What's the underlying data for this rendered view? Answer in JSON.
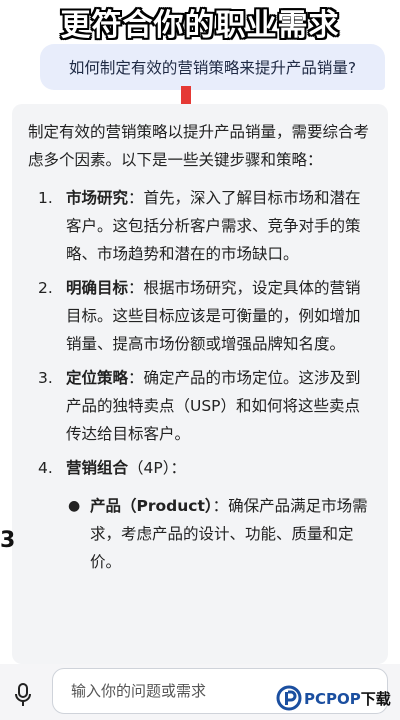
{
  "banner": {
    "text": "更符合你的职业需求"
  },
  "question": {
    "text": "如何制定有效的营销策略来提升产品销量?"
  },
  "answer": {
    "intro": "制定有效的营销策略以提升产品销量，需要综合考虑多个因素。以下是一些关键步骤和策略：",
    "steps": [
      {
        "num": "1.",
        "title": "市场研究",
        "text": "：首先，深入了解目标市场和潜在客户。这包括分析客户需求、竞争对手的策略、市场趋势和潜在的市场缺口。"
      },
      {
        "num": "2.",
        "title": "明确目标",
        "text": "：根据市场研究，设定具体的营销目标。这些目标应该是可衡量的，例如增加销量、提高市场份额或增强品牌知名度。"
      },
      {
        "num": "3.",
        "title": "定位策略",
        "text": "：确定产品的市场定位。这涉及到产品的独特卖点（USP）和如何将这些卖点传达给目标客户。"
      },
      {
        "num": "4.",
        "title": "营销组合",
        "text": "（4P）："
      }
    ],
    "sub_items": [
      {
        "bullet": "●",
        "title": "产品（Product）",
        "text": "：确保产品满足市场需求，考虑产品的设计、功能、质量和定价。"
      }
    ]
  },
  "left_glyph": "3",
  "input": {
    "placeholder": "输入你的问题或需求"
  },
  "watermark": {
    "brand": "PCPOP",
    "suffix": "下载"
  },
  "icons": {
    "arrow": "red-down-arrow-icon",
    "mic": "microphone-icon",
    "logo": "pcpop-logo-icon"
  },
  "colors": {
    "question_bubble": "#e8edfb",
    "answer_card": "#f3f4f6",
    "arrow": "#e53935",
    "brand_blue": "#1b4fa0"
  }
}
